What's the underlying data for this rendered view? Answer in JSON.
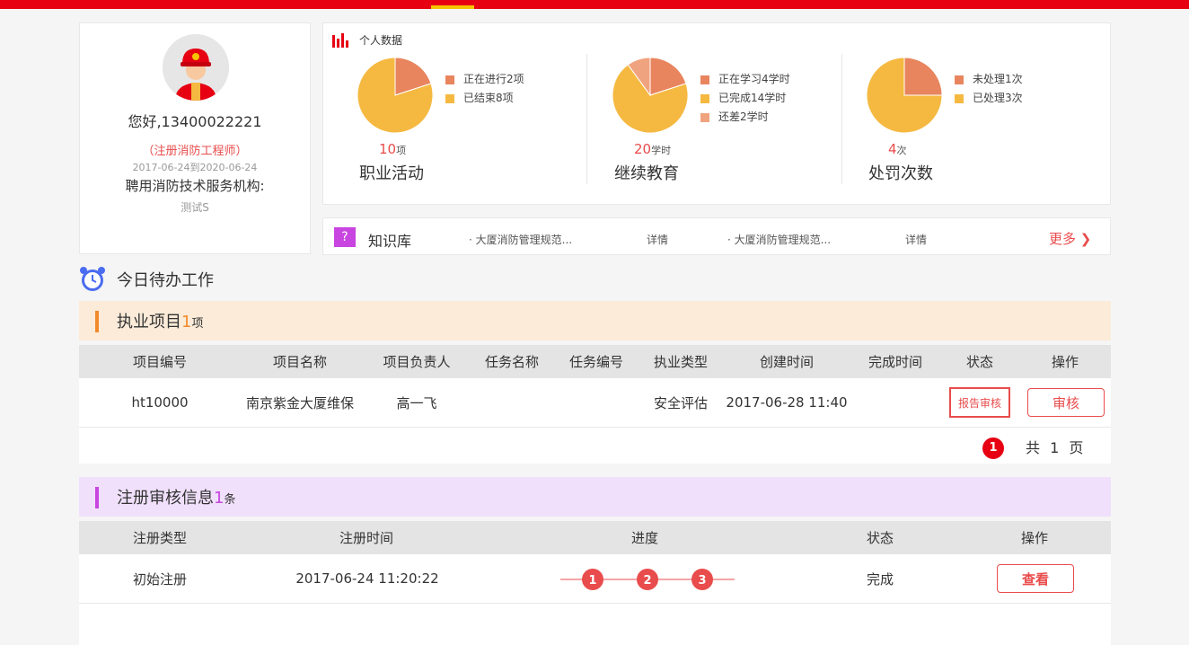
{
  "profile": {
    "greeting": "您好,13400022221",
    "cert": "（注册消防工程师）",
    "period": "2017-06-24到2020-06-24",
    "org_label": "聘用消防技术服务机构:",
    "org_name": "测试S"
  },
  "stats": {
    "header": "个人数据",
    "blocks": [
      {
        "number": "10",
        "unit": "项",
        "title": "职业活动",
        "legend": [
          {
            "label": "正在进行2项",
            "color": "#e8855e"
          },
          {
            "label": "已结束8项",
            "color": "#f5b941"
          }
        ],
        "slices": [
          0.2,
          0.8
        ]
      },
      {
        "number": "20",
        "unit": "学时",
        "title": "继续教育",
        "legend": [
          {
            "label": "正在学习4学时",
            "color": "#e8855e"
          },
          {
            "label": "已完成14学时",
            "color": "#f5b941"
          },
          {
            "label": "还差2学时",
            "color": "#f0a37f"
          }
        ],
        "slices": [
          0.2,
          0.7,
          0.1
        ]
      },
      {
        "number": "4",
        "unit": "次",
        "title": "处罚次数",
        "legend": [
          {
            "label": "未处理1次",
            "color": "#e8855e"
          },
          {
            "label": "已处理3次",
            "color": "#f5b941"
          }
        ],
        "slices": [
          0.25,
          0.75
        ]
      }
    ]
  },
  "knowledge": {
    "icon": "?",
    "title": "知识库",
    "items": [
      {
        "text": "· 大厦消防管理规范...",
        "detail": "详情"
      },
      {
        "text": "· 大厦消防管理规范...",
        "detail": "详情"
      }
    ],
    "more": "更多 ❯"
  },
  "todo": {
    "title": "今日待办工作"
  },
  "projects": {
    "label": "执业项目",
    "count": "1",
    "unit": "项",
    "columns": [
      "项目编号",
      "项目名称",
      "项目负责人",
      "任务名称",
      "任务编号",
      "执业类型",
      "创建时间",
      "完成时间",
      "状态",
      "操作"
    ],
    "row": {
      "id": "ht10000",
      "name": "南京紫金大厦维保",
      "owner": "高一飞",
      "task_name": "",
      "task_id": "",
      "type": "安全评估",
      "created": "2017-06-28 11:40",
      "finished": "",
      "status": "报告审核",
      "action": "审核"
    },
    "pager": {
      "page": "1",
      "total": "共 1 页"
    }
  },
  "registration": {
    "label": "注册审核信息",
    "count": "1",
    "unit": "条",
    "columns": [
      "注册类型",
      "注册时间",
      "进度",
      "状态",
      "操作"
    ],
    "row": {
      "type": "初始注册",
      "time": "2017-06-24 11:20:22",
      "steps": [
        "1",
        "2",
        "3"
      ],
      "status": "完成",
      "action": "查看"
    }
  },
  "colors": {
    "brand_red": "#e60012",
    "accent_red": "#e94c4c",
    "orange": "#f28a2b",
    "purple": "#c845e0",
    "blue": "#4a6cf0"
  }
}
